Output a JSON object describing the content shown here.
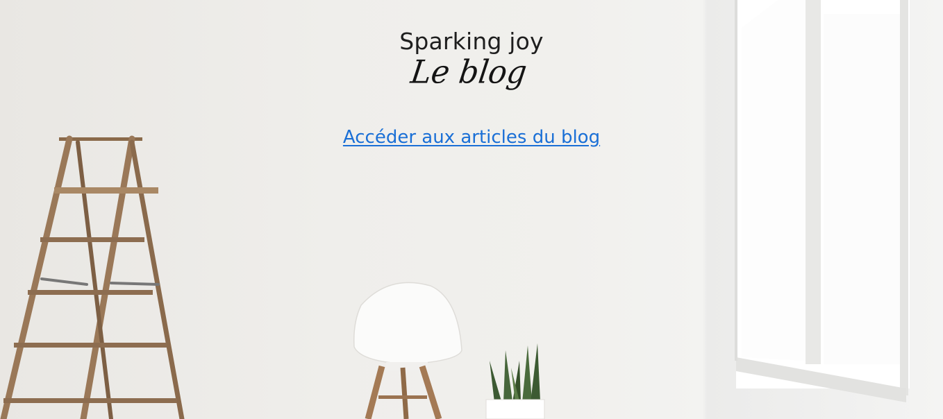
{
  "header": {
    "title": "Sparking joy",
    "subtitle": "Le blog"
  },
  "main": {
    "link_label": "Accéder aux articles du blog"
  },
  "colors": {
    "link": "#1a6fd6",
    "text": "#1e1e1e",
    "wall": "#efeeeb"
  }
}
